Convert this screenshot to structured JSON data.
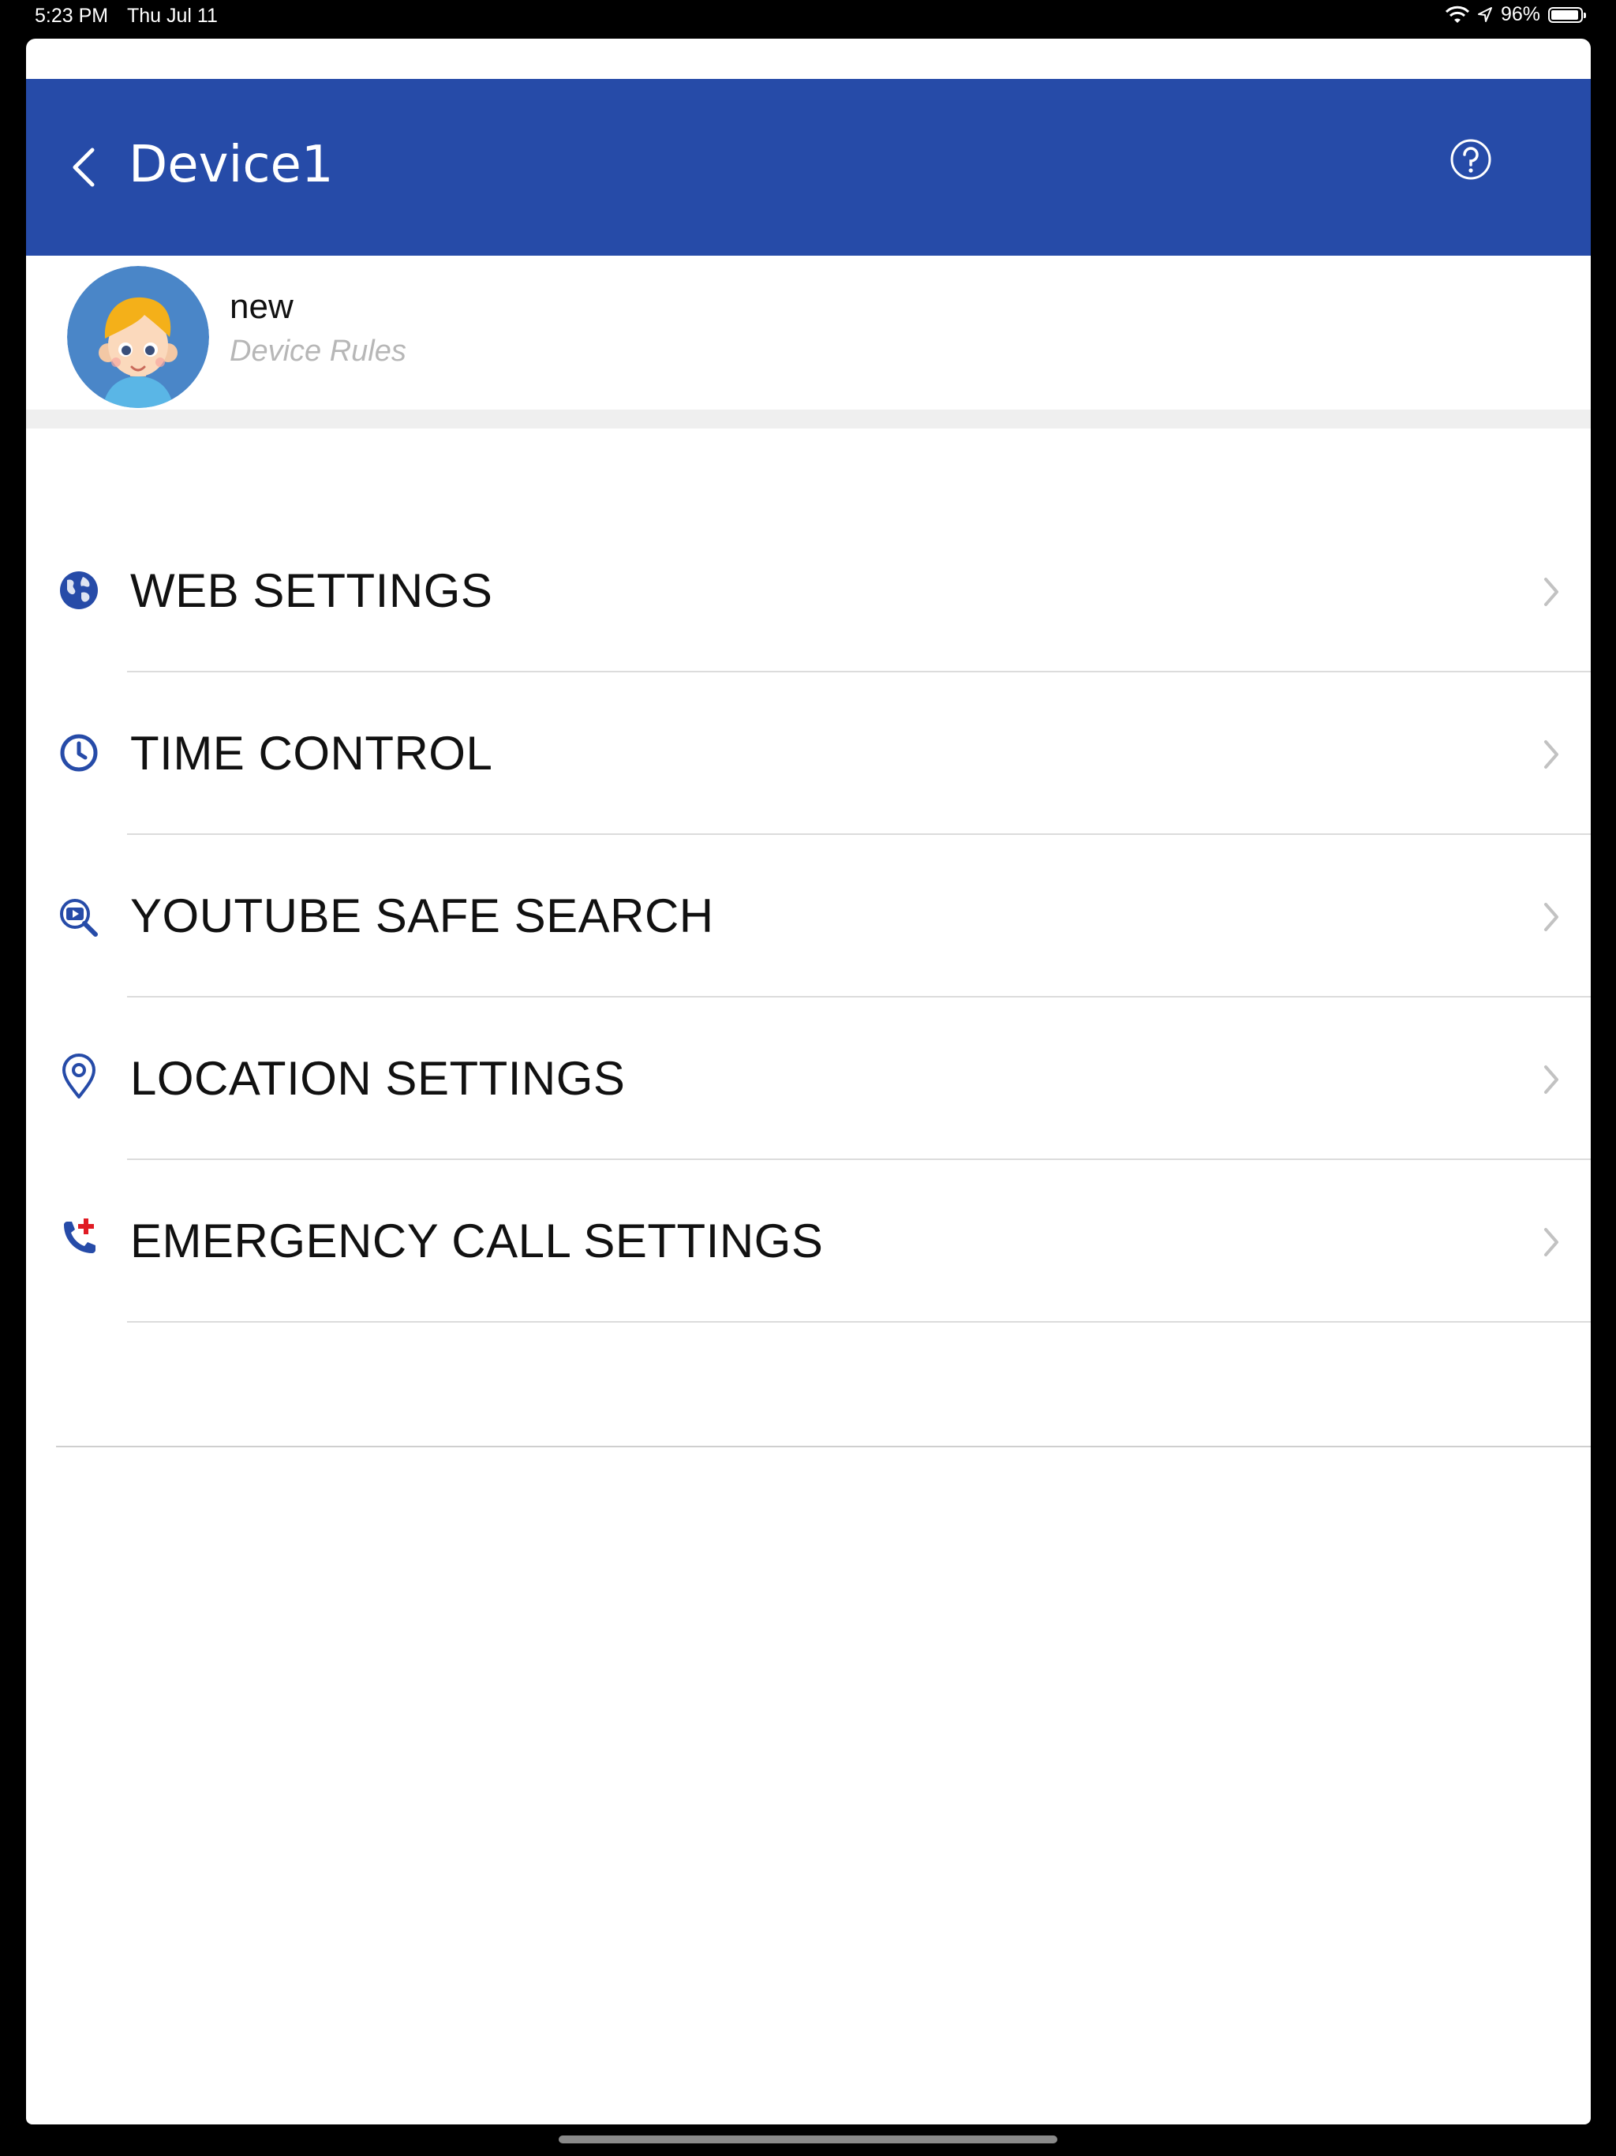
{
  "status_bar": {
    "time": "5:23 PM",
    "date": "Thu Jul 11",
    "battery_percent": "96%"
  },
  "header": {
    "title": "Device1",
    "background_color": "#264ba8"
  },
  "profile": {
    "name": "new",
    "subtitle": "Device Rules"
  },
  "menu": {
    "items": [
      {
        "label": "WEB SETTINGS",
        "icon": "globe-icon"
      },
      {
        "label": "TIME CONTROL",
        "icon": "clock-icon"
      },
      {
        "label": "YOUTUBE SAFE SEARCH",
        "icon": "video-search-icon"
      },
      {
        "label": "LOCATION SETTINGS",
        "icon": "location-pin-icon"
      },
      {
        "label": "EMERGENCY CALL SETTINGS",
        "icon": "emergency-phone-icon"
      }
    ]
  },
  "colors": {
    "accent": "#264ba8",
    "emergency_red": "#e01b24",
    "chevron": "#c2c2c2"
  }
}
